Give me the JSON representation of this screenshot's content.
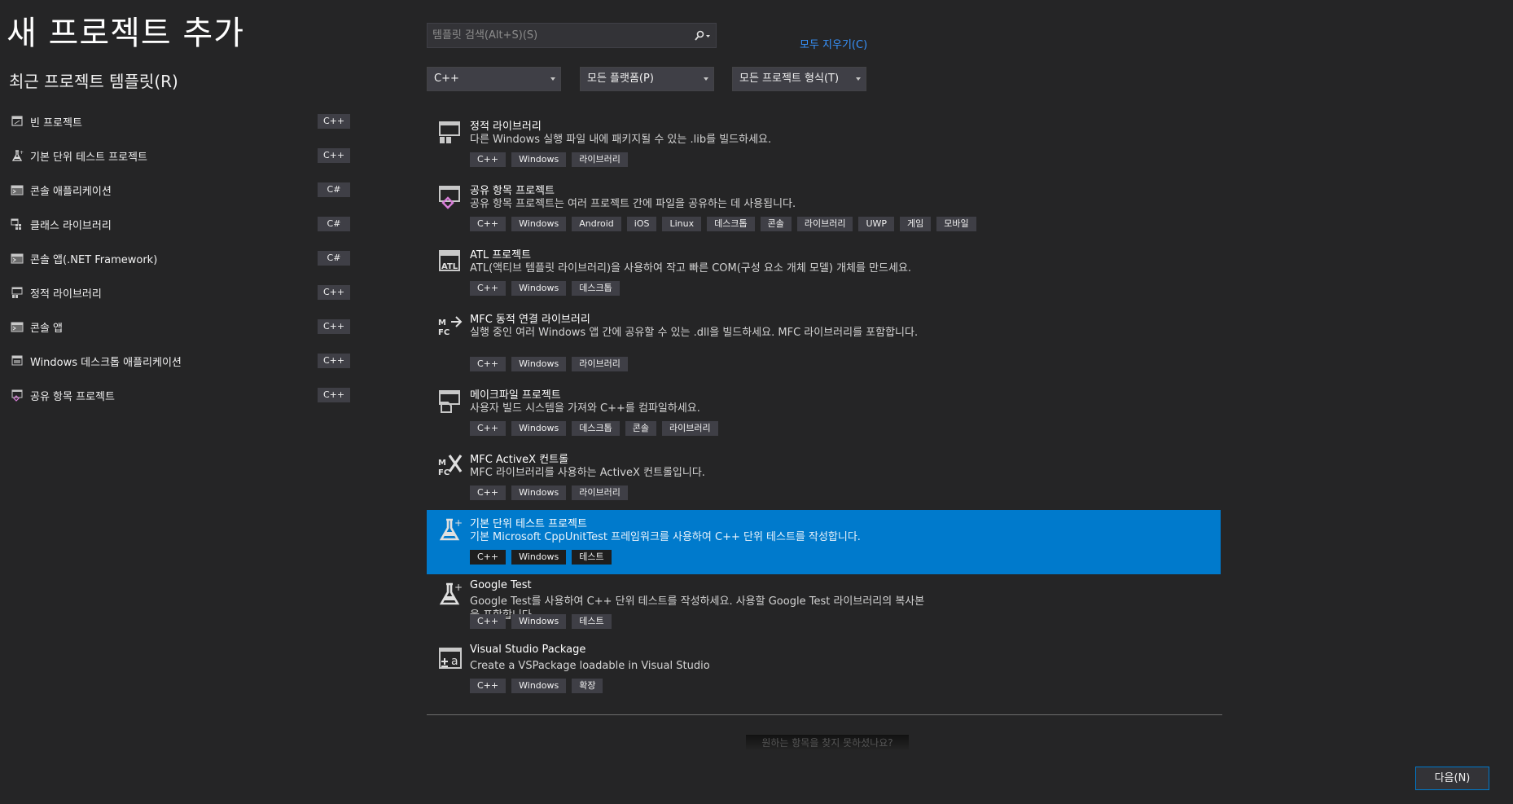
{
  "page": {
    "title": "새 프로젝트 추가",
    "recent_heading": "최근 프로젝트 템플릿(R)"
  },
  "recent_templates": [
    {
      "label": "빈 프로젝트",
      "lang": "C++",
      "icon": "empty-project-icon"
    },
    {
      "label": "기본 단위 테스트 프로젝트",
      "lang": "C++",
      "icon": "flask-icon"
    },
    {
      "label": "콘솔 애플리케이션",
      "lang": "C#",
      "icon": "console-icon"
    },
    {
      "label": "클래스 라이브러리",
      "lang": "C#",
      "icon": "class-library-icon"
    },
    {
      "label": "콘솔 앱(.NET Framework)",
      "lang": "C#",
      "icon": "console-icon"
    },
    {
      "label": "정적 라이브러리",
      "lang": "C++",
      "icon": "static-library-icon"
    },
    {
      "label": "콘솔 앱",
      "lang": "C++",
      "icon": "console-icon"
    },
    {
      "label": "Windows 데스크톱 애플리케이션",
      "lang": "C++",
      "icon": "desktop-app-icon"
    },
    {
      "label": "공유 항목 프로젝트",
      "lang": "C++",
      "icon": "shared-items-icon"
    }
  ],
  "search": {
    "placeholder": "템플릿 검색(Alt+S)(S)",
    "clear_all": "모두 지우기(C)"
  },
  "filters": {
    "language": "C++",
    "platform": "모든 플랫폼(P)",
    "project_type": "모든 프로젝트 형식(T)"
  },
  "templates": [
    {
      "name": "정적 라이브러리",
      "desc": "다른 Windows 실행 파일 내에 패키지될 수 있는 .lib를 빌드하세요.",
      "tags": [
        "C++",
        "Windows",
        "라이브러리"
      ],
      "icon": "static-library-icon"
    },
    {
      "name": "공유 항목 프로젝트",
      "desc": "공유 항목 프로젝트는 여러 프로젝트 간에 파일을 공유하는 데 사용됩니다.",
      "tags": [
        "C++",
        "Windows",
        "Android",
        "iOS",
        "Linux",
        "데스크톱",
        "콘솔",
        "라이브러리",
        "UWP",
        "게임",
        "모바일"
      ],
      "icon": "shared-items-icon"
    },
    {
      "name": "ATL 프로젝트",
      "desc": "ATL(액티브 템플릿 라이브러리)을 사용하여 작고 빠른 COM(구성 요소 개체 모델) 개체를 만드세요.",
      "tags": [
        "C++",
        "Windows",
        "데스크톱"
      ],
      "icon": "atl-icon"
    },
    {
      "name": "MFC 동적 연결 라이브러리",
      "desc": "실행 중인 여러 Windows 앱 간에 공유할 수 있는 .dll을 빌드하세요. MFC 라이브러리를 포함합니다.",
      "tags": [
        "C++",
        "Windows",
        "라이브러리"
      ],
      "icon": "mfc-dll-icon"
    },
    {
      "name": "메이크파일 프로젝트",
      "desc": "사용자 빌드 시스템을 가져와 C++를 컴파일하세요.",
      "tags": [
        "C++",
        "Windows",
        "데스크톱",
        "콘솔",
        "라이브러리"
      ],
      "icon": "makefile-icon"
    },
    {
      "name": "MFC ActiveX 컨트롤",
      "desc": "MFC 라이브러리를 사용하는 ActiveX 컨트롤입니다.",
      "tags": [
        "C++",
        "Windows",
        "라이브러리"
      ],
      "icon": "mfc-activex-icon"
    },
    {
      "name": "기본 단위 테스트 프로젝트",
      "desc": "기본 Microsoft CppUnitTest 프레임워크를 사용하여 C++ 단위 테스트를 작성합니다.",
      "tags": [
        "C++",
        "Windows",
        "테스트"
      ],
      "icon": "flask-icon",
      "selected": true
    },
    {
      "name": "Google Test",
      "desc": "Google Test를 사용하여 C++ 단위 테스트를 작성하세요. 사용할 Google Test 라이브러리의 복사본을 포함합니다.",
      "tags": [
        "C++",
        "Windows",
        "테스트"
      ],
      "icon": "flask-icon"
    },
    {
      "name": "Visual Studio Package",
      "desc": "Create a VSPackage loadable in Visual Studio",
      "tags": [
        "C++",
        "Windows",
        "확장"
      ],
      "icon": "vs-package-icon"
    }
  ],
  "footer": {
    "not_found": "원하는 항목을 찾지 못하셨나요?",
    "next_button": "다음(N)"
  },
  "colors": {
    "background": "#252526",
    "selected": "#007acc",
    "link": "#3794ff",
    "tag": "#3f3f46"
  }
}
